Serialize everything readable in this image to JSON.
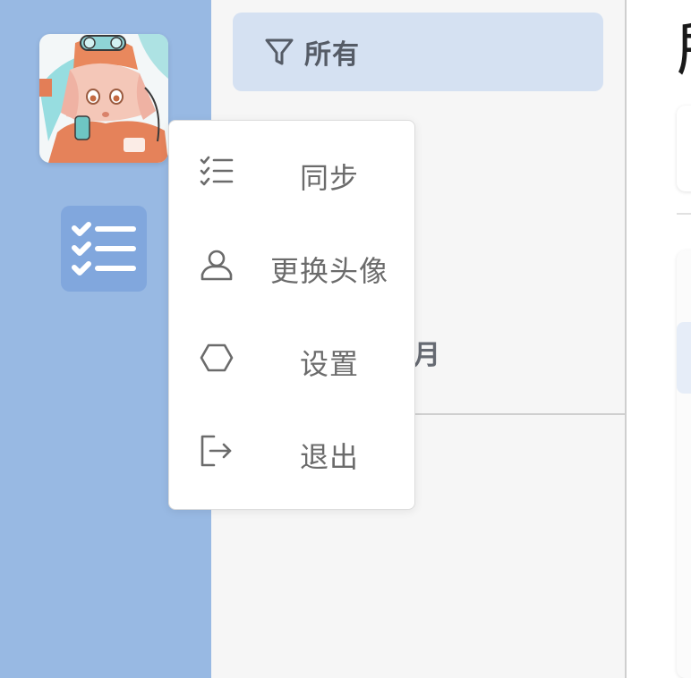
{
  "filter": {
    "all_label": "所有",
    "partial_label": "月"
  },
  "main": {
    "title_partial": "所"
  },
  "menu": {
    "items": [
      {
        "label": "同步",
        "icon": "checklist-icon"
      },
      {
        "label": "更换头像",
        "icon": "user-icon"
      },
      {
        "label": "设置",
        "icon": "hexagon-icon"
      },
      {
        "label": "退出",
        "icon": "logout-icon"
      }
    ]
  },
  "colors": {
    "rail_bg": "#98b9e3",
    "rail_active": "#81a7dd",
    "filter_selected": "#d5e1f2",
    "menu_text": "#6b6b6b"
  }
}
